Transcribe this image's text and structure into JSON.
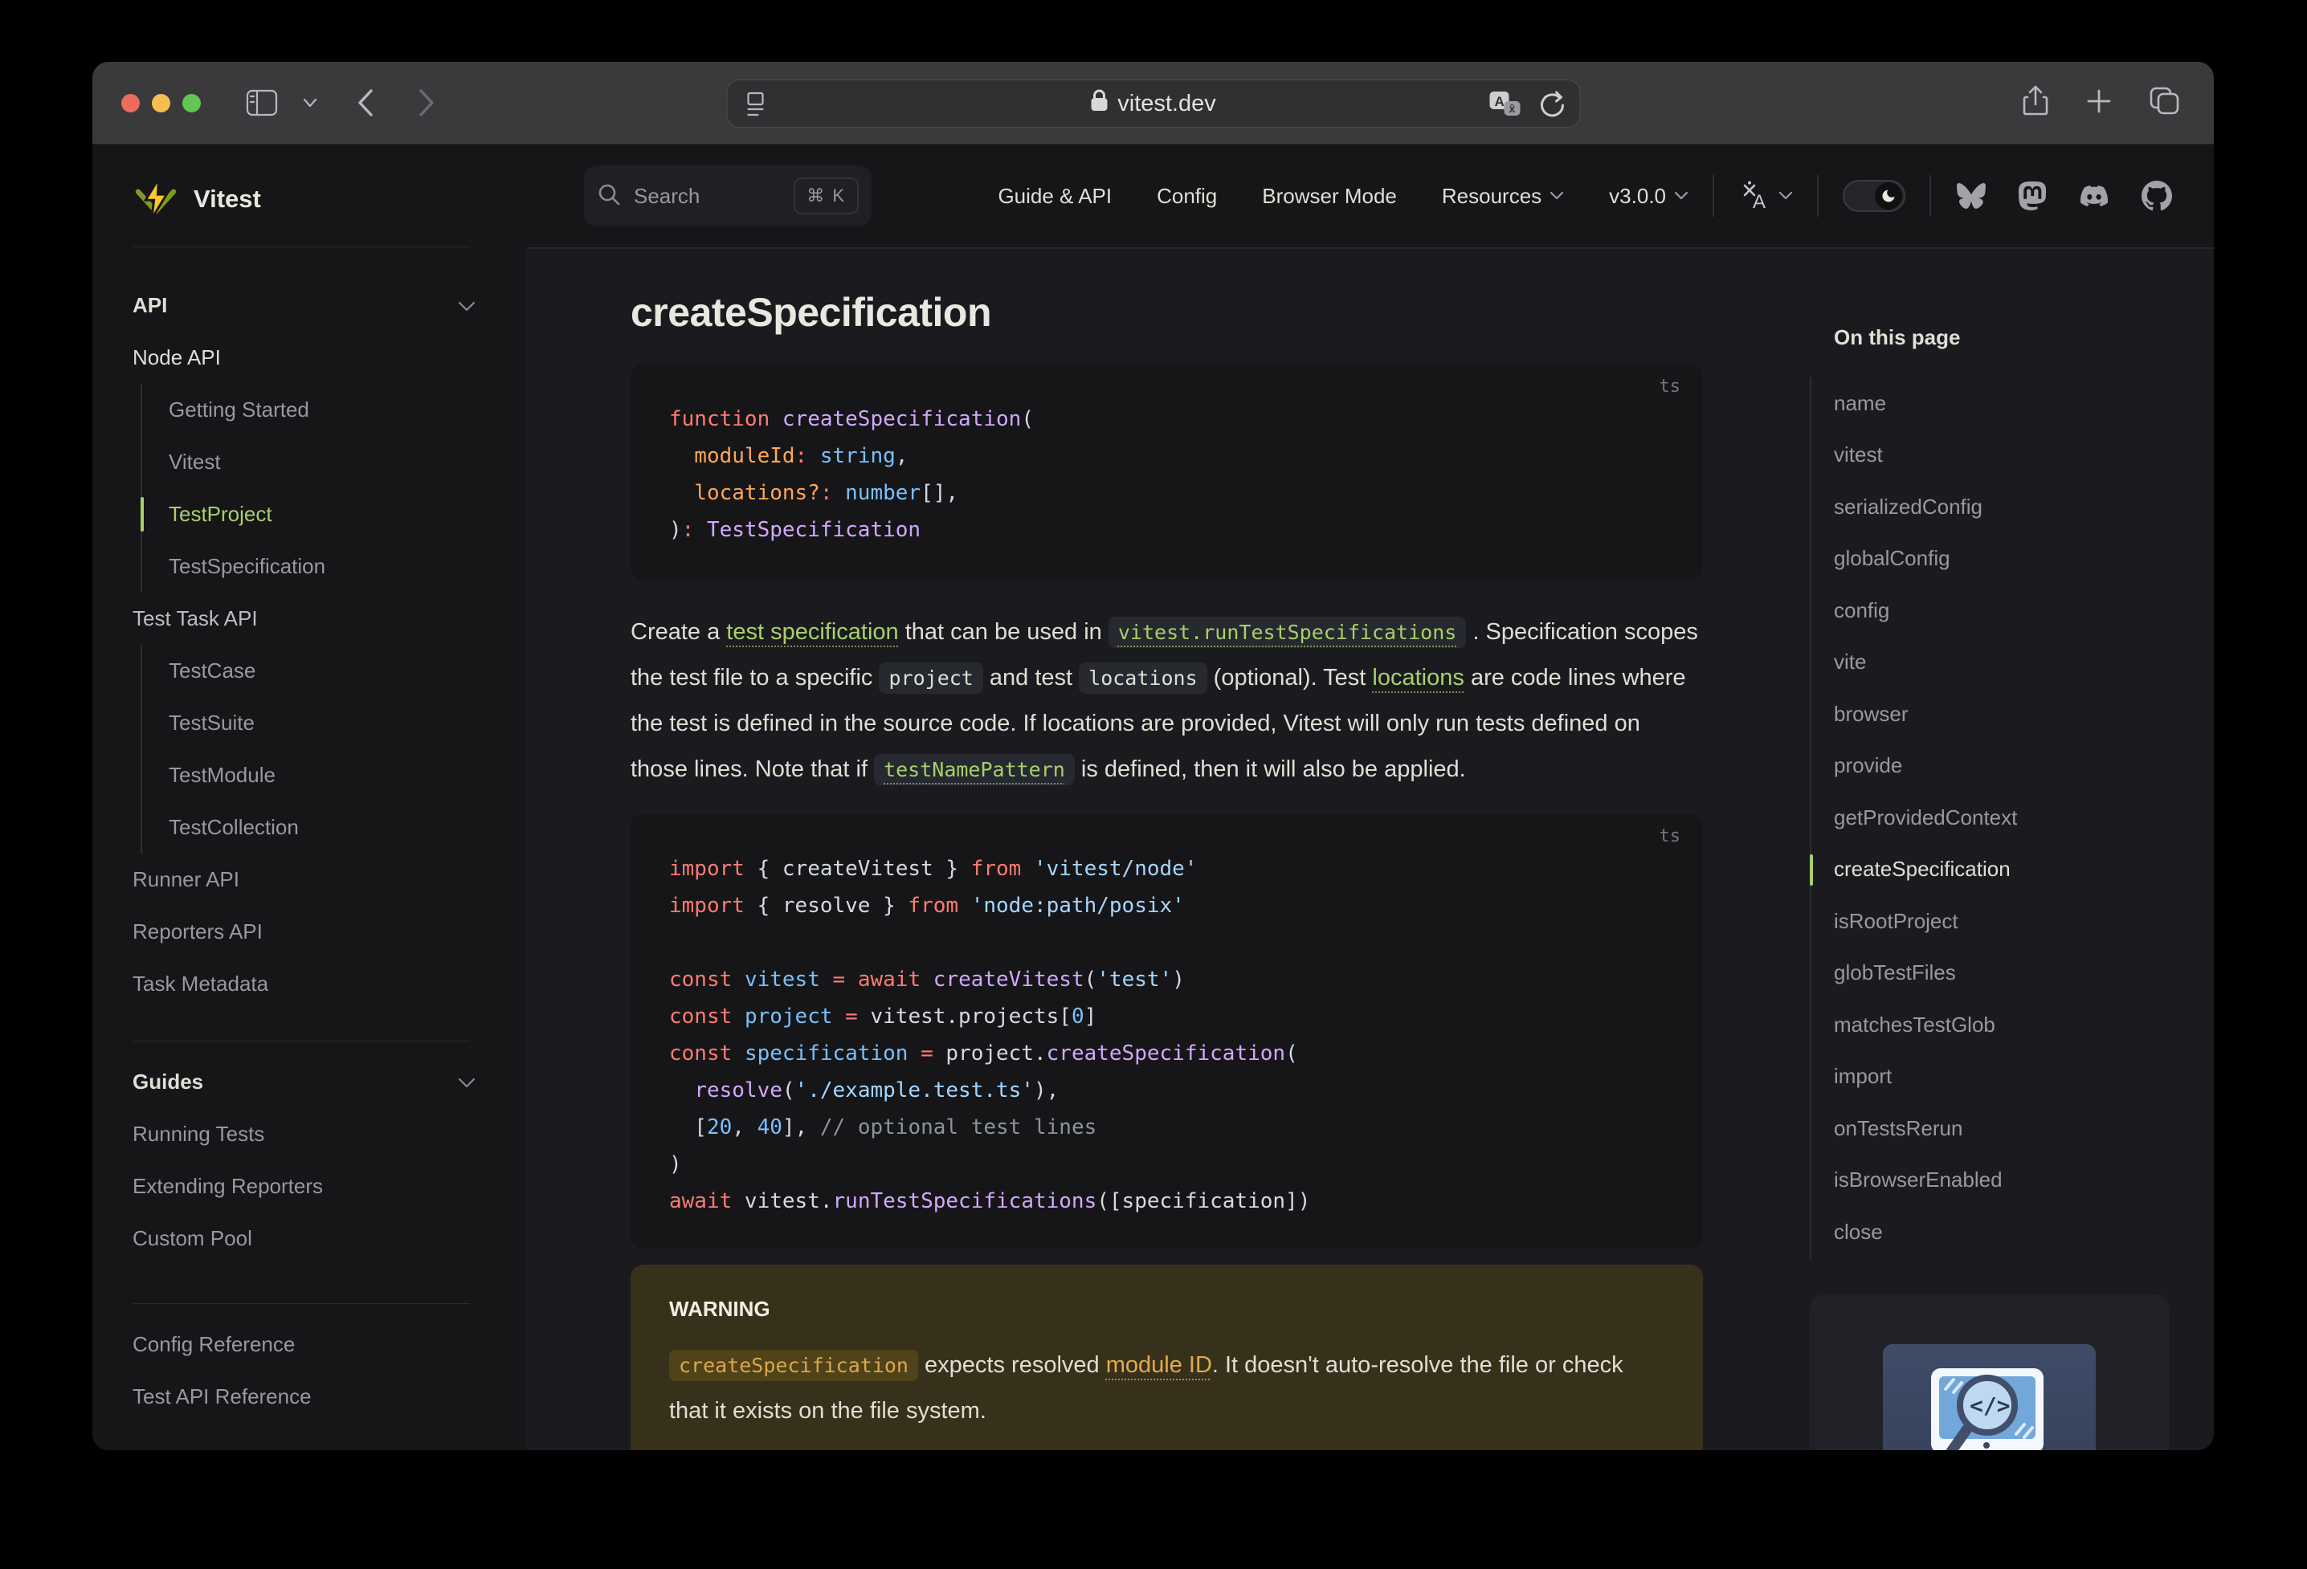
{
  "browser": {
    "url": "vitest.dev",
    "icons": [
      "sidebar-toggle",
      "chevron-down",
      "back",
      "forward",
      "reader",
      "lock",
      "translate",
      "reload",
      "share",
      "new-tab",
      "tabs-overview"
    ]
  },
  "nav": {
    "search": {
      "label": "Search",
      "shortcut": "⌘ K"
    },
    "menu": [
      {
        "label": "Guide & API"
      },
      {
        "label": "Config"
      },
      {
        "label": "Browser Mode"
      },
      {
        "label": "Resources",
        "chevron": true
      },
      {
        "label": "v3.0.0",
        "chevron": true
      }
    ],
    "icons": [
      "translate",
      "theme-toggle-moon",
      "bluesky",
      "mastodon",
      "discord",
      "github"
    ]
  },
  "sidebar": {
    "logo": "Vitest",
    "section_api": "API",
    "node_api_label": "Node API",
    "node_api_items": [
      {
        "label": "Getting Started"
      },
      {
        "label": "Vitest"
      },
      {
        "label": "TestProject",
        "active": true
      },
      {
        "label": "TestSpecification"
      }
    ],
    "task_api_label": "Test Task API",
    "task_api_items": [
      {
        "label": "TestCase"
      },
      {
        "label": "TestSuite"
      },
      {
        "label": "TestModule"
      },
      {
        "label": "TestCollection"
      }
    ],
    "api_links": [
      {
        "label": "Runner API"
      },
      {
        "label": "Reporters API"
      },
      {
        "label": "Task Metadata"
      }
    ],
    "section_guides": "Guides",
    "guides_links": [
      {
        "label": "Running Tests"
      },
      {
        "label": "Extending Reporters"
      },
      {
        "label": "Custom Pool"
      }
    ],
    "bottom_links": [
      {
        "label": "Config Reference"
      },
      {
        "label": "Test API Reference"
      }
    ]
  },
  "content": {
    "title": "createSpecification",
    "code1": {
      "lang": "ts",
      "lines": [
        [
          {
            "t": "function ",
            "c": "kw"
          },
          {
            "t": "createSpecification",
            "c": "fn"
          },
          {
            "t": "(",
            "c": "fg"
          }
        ],
        [
          {
            "t": "  moduleId",
            "c": "arg"
          },
          {
            "t": ":",
            "c": "kw"
          },
          {
            "t": " ",
            "c": "fg"
          },
          {
            "t": "string",
            "c": "type"
          },
          {
            "t": ",",
            "c": "fg"
          }
        ],
        [
          {
            "t": "  locations?",
            "c": "arg"
          },
          {
            "t": ":",
            "c": "kw"
          },
          {
            "t": " ",
            "c": "fg"
          },
          {
            "t": "number",
            "c": "type"
          },
          {
            "t": "[],",
            "c": "fg"
          }
        ],
        [
          {
            "t": ")",
            "c": "fg"
          },
          {
            "t": ":",
            "c": "kw"
          },
          {
            "t": " ",
            "c": "fg"
          },
          {
            "t": "TestSpecification",
            "c": "fn"
          }
        ]
      ]
    },
    "paragraph": [
      {
        "t": "Create a ",
        "s": "plain"
      },
      {
        "t": "test specification",
        "s": "link"
      },
      {
        "t": " that can be used in ",
        "s": "plain"
      },
      {
        "t": "vitest.runTestSpecifications",
        "s": "codelink"
      },
      {
        "t": " . Specification scopes the test file to a specific ",
        "s": "plain"
      },
      {
        "t": "project",
        "s": "code"
      },
      {
        "t": " and test ",
        "s": "plain"
      },
      {
        "t": "locations",
        "s": "code"
      },
      {
        "t": " (optional). Test ",
        "s": "plain"
      },
      {
        "t": "locations",
        "s": "link"
      },
      {
        "t": " are code lines where the test is defined in the source code. If locations are provided, Vitest will only run tests defined on those lines. Note that if ",
        "s": "plain"
      },
      {
        "t": "testNamePattern",
        "s": "codelink"
      },
      {
        "t": " is defined, then it will also be applied.",
        "s": "plain"
      }
    ],
    "code2": {
      "lang": "ts",
      "lines": [
        [
          {
            "t": "import",
            "c": "kw"
          },
          {
            "t": " { createVitest } ",
            "c": "fg"
          },
          {
            "t": "from",
            "c": "kw"
          },
          {
            "t": " ",
            "c": "fg"
          },
          {
            "t": "'vitest/node'",
            "c": "str"
          }
        ],
        [
          {
            "t": "import",
            "c": "kw"
          },
          {
            "t": " { resolve } ",
            "c": "fg"
          },
          {
            "t": "from",
            "c": "kw"
          },
          {
            "t": " ",
            "c": "fg"
          },
          {
            "t": "'node:path/posix'",
            "c": "str"
          }
        ],
        [],
        [
          {
            "t": "const",
            "c": "kw"
          },
          {
            "t": " ",
            "c": "fg"
          },
          {
            "t": "vitest",
            "c": "var"
          },
          {
            "t": " ",
            "c": "fg"
          },
          {
            "t": "=",
            "c": "kw"
          },
          {
            "t": " ",
            "c": "fg"
          },
          {
            "t": "await",
            "c": "kw"
          },
          {
            "t": " ",
            "c": "fg"
          },
          {
            "t": "createVitest",
            "c": "fn"
          },
          {
            "t": "(",
            "c": "fg"
          },
          {
            "t": "'test'",
            "c": "str"
          },
          {
            "t": ")",
            "c": "fg"
          }
        ],
        [
          {
            "t": "const",
            "c": "kw"
          },
          {
            "t": " ",
            "c": "fg"
          },
          {
            "t": "project",
            "c": "var"
          },
          {
            "t": " ",
            "c": "fg"
          },
          {
            "t": "=",
            "c": "kw"
          },
          {
            "t": " vitest.projects[",
            "c": "fg"
          },
          {
            "t": "0",
            "c": "num"
          },
          {
            "t": "]",
            "c": "fg"
          }
        ],
        [
          {
            "t": "const",
            "c": "kw"
          },
          {
            "t": " ",
            "c": "fg"
          },
          {
            "t": "specification",
            "c": "var"
          },
          {
            "t": " ",
            "c": "fg"
          },
          {
            "t": "=",
            "c": "kw"
          },
          {
            "t": " project.",
            "c": "fg"
          },
          {
            "t": "createSpecification",
            "c": "fn"
          },
          {
            "t": "(",
            "c": "fg"
          }
        ],
        [
          {
            "t": "  ",
            "c": "fg"
          },
          {
            "t": "resolve",
            "c": "fn"
          },
          {
            "t": "(",
            "c": "fg"
          },
          {
            "t": "'./example.test.ts'",
            "c": "str"
          },
          {
            "t": "),",
            "c": "fg"
          }
        ],
        [
          {
            "t": "  [",
            "c": "fg"
          },
          {
            "t": "20",
            "c": "num"
          },
          {
            "t": ", ",
            "c": "fg"
          },
          {
            "t": "40",
            "c": "num"
          },
          {
            "t": "], ",
            "c": "fg"
          },
          {
            "t": "// optional test lines",
            "c": "com"
          }
        ],
        [
          {
            "t": ")",
            "c": "fg"
          }
        ],
        [
          {
            "t": "await",
            "c": "kw"
          },
          {
            "t": " vitest.",
            "c": "fg"
          },
          {
            "t": "runTestSpecifications",
            "c": "fn"
          },
          {
            "t": "([specification])",
            "c": "fg"
          }
        ]
      ]
    },
    "warning": {
      "title": "WARNING",
      "segments": [
        {
          "t": "createSpecification",
          "s": "wcode"
        },
        {
          "t": " expects resolved ",
          "s": "plain"
        },
        {
          "t": "module ID",
          "s": "wlink"
        },
        {
          "t": ". It doesn't auto-resolve the file or check that it exists on the file system.",
          "s": "plain"
        }
      ]
    }
  },
  "aside": {
    "title": "On this page",
    "items": [
      {
        "label": "name"
      },
      {
        "label": "vitest"
      },
      {
        "label": "serializedConfig"
      },
      {
        "label": "globalConfig"
      },
      {
        "label": "config"
      },
      {
        "label": "vite"
      },
      {
        "label": "browser"
      },
      {
        "label": "provide"
      },
      {
        "label": "getProvidedContext"
      },
      {
        "label": "createSpecification",
        "active": true
      },
      {
        "label": "isRootProject"
      },
      {
        "label": "globTestFiles"
      },
      {
        "label": "matchesTestGlob"
      },
      {
        "label": "import"
      },
      {
        "label": "onTestsRerun"
      },
      {
        "label": "isBrowserEnabled"
      },
      {
        "label": "close"
      }
    ]
  },
  "colors": {
    "brand_green": "#a8d06a",
    "bg_page": "#1b1b1f",
    "bg_alt": "#161618",
    "warning_bg": "#37311c",
    "code_keyword": "#ff7b72",
    "code_function": "#d2a8ff",
    "code_string": "#a5d6ff",
    "code_constant": "#79c0ff",
    "code_parameter": "#ffa657",
    "code_comment": "#8b949e"
  }
}
